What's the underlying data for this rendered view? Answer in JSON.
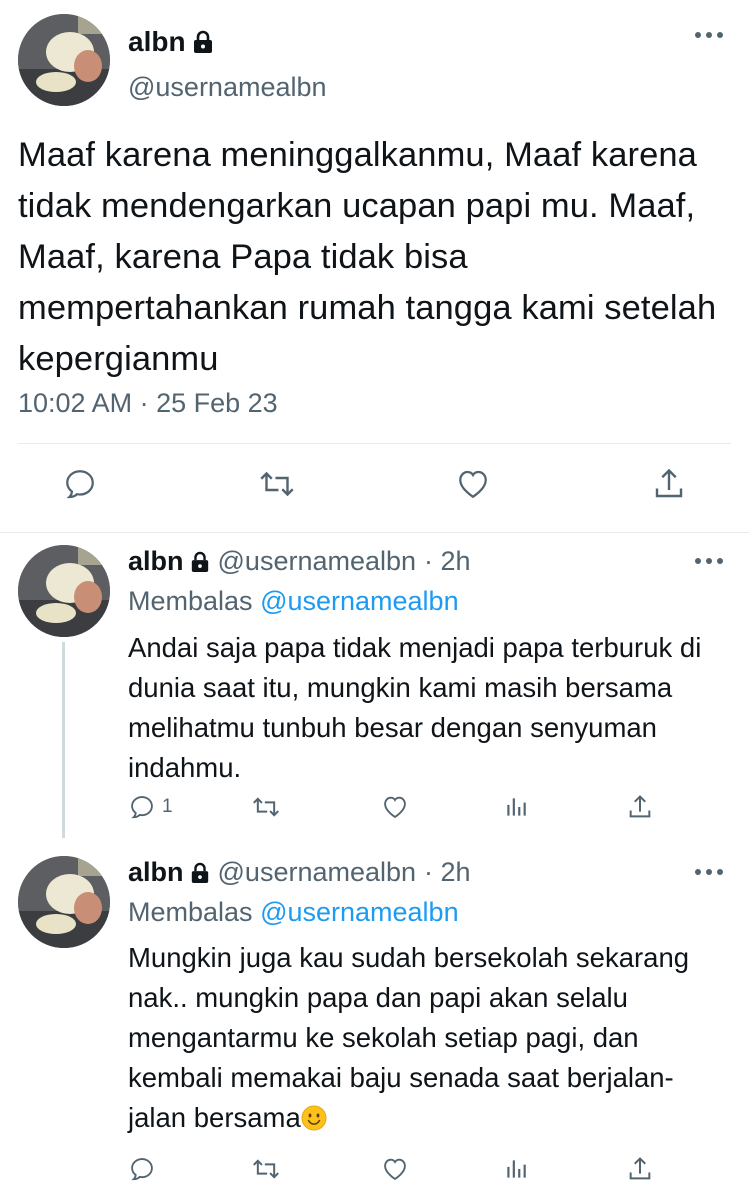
{
  "main_tweet": {
    "name": "albn",
    "handle": "@usernamealbn",
    "text": "Maaf karena meninggalkanmu, Maaf karena tidak mendengarkan ucapan papi mu. Maaf, Maaf, karena Papa tidak bisa mempertahankan rumah tangga kami setelah kepergianmu",
    "timestamp": "10:02 AM · 25 Feb 23",
    "actions": [
      "reply-icon",
      "retweet-icon",
      "like-icon",
      "share-icon"
    ]
  },
  "replies": [
    {
      "name": "albn",
      "handle": "@usernamealbn",
      "time": "· 2h",
      "replying_label": "Membalas",
      "replying_to": "@usernamealbn",
      "text": "Andai saja papa tidak menjadi papa terburuk di dunia saat itu, mungkin kami masih bersama melihatmu tunbuh besar dengan senyuman indahmu.",
      "reply_count": "1"
    },
    {
      "name": "albn",
      "handle": "@usernamealbn",
      "time": "· 2h",
      "replying_label": "Membalas",
      "replying_to": "@usernamealbn",
      "text": "Mungkin juga kau sudah bersekolah sekarang nak.. mungkin papa dan papi akan selalu mengantarmu ke sekolah setiap pagi, dan kembali memakai baju senada saat berjalan-jalan bersama",
      "reply_count": ""
    }
  ],
  "colors": {
    "text": "#0f1419",
    "secondary": "#536471",
    "link": "#1d9bf0",
    "divider": "#e6ecf0"
  }
}
